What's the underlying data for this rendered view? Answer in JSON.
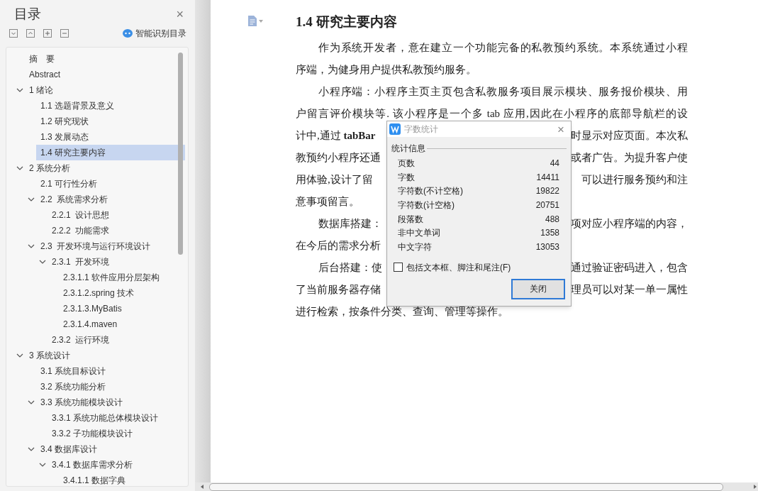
{
  "sidebar": {
    "title": "目录",
    "close": "×",
    "smart_toc": "智能识别目录",
    "tree": [
      {
        "label": "摘　要",
        "selected": false
      },
      {
        "label": "Abstract",
        "selected": false
      },
      {
        "label": "1 绪论",
        "selected": false,
        "expanded": true,
        "children": [
          {
            "label": "1.1 选题背景及意义",
            "selected": false
          },
          {
            "label": "1.2 研究现状",
            "selected": false
          },
          {
            "label": "1.3 发展动态",
            "selected": false
          },
          {
            "label": "1.4 研究主要内容",
            "selected": true
          }
        ]
      },
      {
        "label": "2 系统分析",
        "selected": false,
        "expanded": true,
        "children": [
          {
            "label": "2.1 可行性分析",
            "selected": false
          },
          {
            "label": "2.2  系统需求分析",
            "selected": false,
            "expanded": true,
            "children": [
              {
                "label": "2.2.1  设计思想",
                "selected": false
              },
              {
                "label": "2.2.2  功能需求",
                "selected": false
              }
            ]
          },
          {
            "label": "2.3  开发环境与运行环境设计",
            "selected": false,
            "expanded": true,
            "children": [
              {
                "label": "2.3.1  开发环境",
                "selected": false,
                "expanded": true,
                "children": [
                  {
                    "label": "2.3.1.1 软件应用分层架构",
                    "selected": false
                  },
                  {
                    "label": "2.3.1.2.spring 技术",
                    "selected": false
                  },
                  {
                    "label": "2.3.1.3.MyBatis",
                    "selected": false
                  },
                  {
                    "label": "2.3.1.4.maven",
                    "selected": false
                  }
                ]
              },
              {
                "label": "2.3.2  运行环境",
                "selected": false
              }
            ]
          }
        ]
      },
      {
        "label": "3 系统设计",
        "selected": false,
        "expanded": true,
        "children": [
          {
            "label": "3.1 系统目标设计",
            "selected": false
          },
          {
            "label": "3.2 系统功能分析",
            "selected": false
          },
          {
            "label": "3.3 系统功能模块设计",
            "selected": false,
            "expanded": true,
            "children": [
              {
                "label": "3.3.1 系统功能总体模块设计",
                "selected": false
              },
              {
                "label": "3.3.2 子功能模块设计",
                "selected": false
              }
            ]
          },
          {
            "label": "3.4 数据库设计",
            "selected": false,
            "expanded": true,
            "children": [
              {
                "label": "3.4.1 数据库需求分析",
                "selected": false,
                "expanded": true,
                "children": [
                  {
                    "label": "3.4.1.1 数据字典",
                    "selected": false
                  }
                ]
              }
            ]
          }
        ]
      }
    ]
  },
  "document": {
    "heading": "1.4 研究主要内容",
    "lines": [
      {
        "kind": "full",
        "indent": true,
        "text": "作为系统开发者，意在建立一个功能完备的私教预约系统。本系统通过小程"
      },
      {
        "kind": "end",
        "indent": false,
        "text": "序端，为健身用户提供私教预约服务。"
      },
      {
        "kind": "full",
        "indent": true,
        "text": "小程序端：小程序主页主页包含私教服务项目展示模块、服务报价模块、用"
      },
      {
        "kind": "full",
        "indent": false,
        "text": "户留言评价模块等. 该小程序是一个多 tab 应用,因此在小程序的底部导航栏的设"
      },
      {
        "kind": "split",
        "indent": false,
        "left": "计中,通过 **tabBar**",
        "right": "时显示对应页面。本次私"
      },
      {
        "kind": "split",
        "indent": false,
        "left": "教预约小程序还通",
        "right": "或者广告。为提升客户使"
      },
      {
        "kind": "split",
        "indent": false,
        "left": "用体验,设计了留",
        "right": "可以进行服务预约和注"
      },
      {
        "kind": "end",
        "indent": false,
        "text": "意事项留言。"
      },
      {
        "kind": "split",
        "indent": true,
        "left": "数据库搭建：",
        "right": "项对应小程序端的内容，"
      },
      {
        "kind": "end",
        "indent": false,
        "text": "在今后的需求分析"
      },
      {
        "kind": "split",
        "indent": true,
        "left": "后台搭建：使",
        "right": "通过验证密码进入，包含"
      },
      {
        "kind": "split",
        "indent": false,
        "left": "了当前服务器存储",
        "right": "理员可以对某一单一属性"
      },
      {
        "kind": "end",
        "indent": false,
        "text": "进行检索，按条件分类、查询、管理等操作。"
      }
    ]
  },
  "dialog": {
    "title": "字数统计",
    "close": "×",
    "group": "统计信息",
    "stats": [
      {
        "label": "页数",
        "value": "44"
      },
      {
        "label": "字数",
        "value": "14411"
      },
      {
        "label": "字符数(不计空格)",
        "value": "19822"
      },
      {
        "label": "字符数(计空格)",
        "value": "20751"
      },
      {
        "label": "段落数",
        "value": "488"
      },
      {
        "label": "非中文单词",
        "value": "1358"
      },
      {
        "label": "中文字符",
        "value": "13053"
      }
    ],
    "include": {
      "label": "包括文本框、脚注和尾注(F)",
      "checked": false
    },
    "button": "关闭"
  }
}
